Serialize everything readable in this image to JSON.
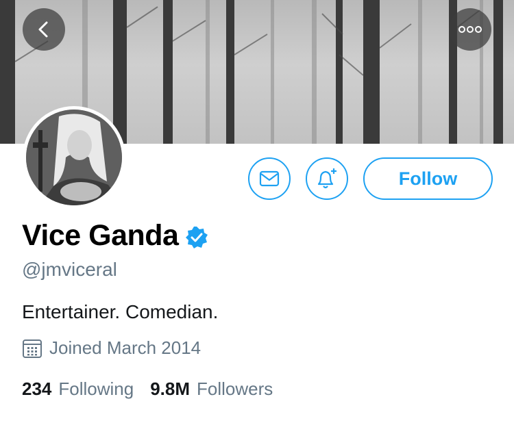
{
  "header": {
    "back_icon": "chevron-left-icon",
    "more_icon": "ellipsis-icon"
  },
  "actions": {
    "message_icon": "envelope-icon",
    "notify_icon": "bell-plus-icon",
    "follow_label": "Follow"
  },
  "profile": {
    "name": "Vice Ganda",
    "verified_icon": "verified-badge-icon",
    "handle": "@jmviceral",
    "bio": "Entertainer. Comedian.",
    "joined": "Joined March 2014",
    "joined_icon": "calendar-icon"
  },
  "stats": {
    "following_count": "234",
    "following_label": "Following",
    "followers_count": "9.8M",
    "followers_label": "Followers"
  },
  "colors": {
    "accent": "#1da1f2",
    "secondary_text": "#657786",
    "primary_text": "#14171a"
  }
}
